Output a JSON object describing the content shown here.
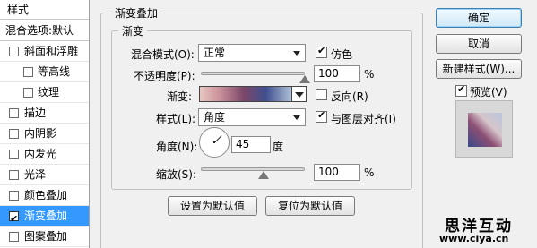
{
  "styles_panel": {
    "header": "样式",
    "blend_options": "混合选项:默认",
    "items": [
      {
        "label": "斜面和浮雕",
        "checked": false
      },
      {
        "label": "等高线",
        "checked": false,
        "indent": true
      },
      {
        "label": "纹理",
        "checked": false,
        "indent": true
      },
      {
        "label": "描边",
        "checked": false
      },
      {
        "label": "内阴影",
        "checked": false
      },
      {
        "label": "内发光",
        "checked": false
      },
      {
        "label": "光泽",
        "checked": false
      },
      {
        "label": "颜色叠加",
        "checked": false
      },
      {
        "label": "渐变叠加",
        "checked": true,
        "active": true
      },
      {
        "label": "图案叠加",
        "checked": false
      }
    ]
  },
  "gradient_overlay": {
    "title": "渐变叠加",
    "section_title": "渐变",
    "blend_mode_label": "混合模式(O):",
    "blend_mode_value": "正常",
    "dither_label": "仿色",
    "dither_checked": true,
    "opacity_label": "不透明度(P):",
    "opacity_value": "100",
    "opacity_unit": "%",
    "opacity_level": 1.0,
    "gradient_label": "渐变:",
    "reverse_label": "反向(R)",
    "reverse_checked": false,
    "style_label": "样式(L):",
    "style_value": "角度",
    "align_label": "与图层对齐(I)",
    "align_checked": true,
    "angle_label": "角度(N):",
    "angle_value": "45",
    "angle_unit": "度",
    "scale_label": "缩放(S):",
    "scale_value": "100",
    "scale_unit": "%",
    "scale_level": 0.6,
    "set_default_button": "设置为默认值",
    "reset_default_button": "复位为默认值"
  },
  "right_panel": {
    "ok_button": "确定",
    "cancel_button": "取消",
    "new_style_button": "新建样式(W)...",
    "preview_label": "预览(V)",
    "preview_checked": true
  },
  "watermark": {
    "title": "思洋互动",
    "url": "www.ciya.cn"
  },
  "colors": {
    "active_item": "#3399ff",
    "gradient_stops": [
      "#e8c7c0",
      "#c98f9a",
      "#7b4769",
      "#3f4f8e",
      "#aebfd6"
    ]
  },
  "icons": [
    "check-icon",
    "dropdown-arrow-icon",
    "angle-dial-icon"
  ]
}
